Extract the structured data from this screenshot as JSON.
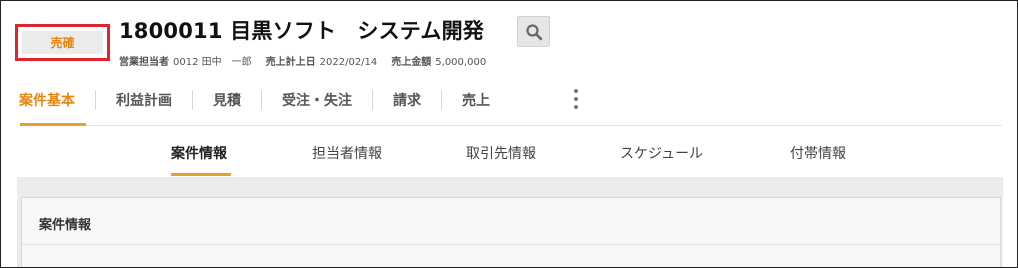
{
  "header": {
    "status_badge": "売確",
    "title": "1800011 目黒ソフト　システム開発",
    "search_icon": "search-icon",
    "meta": [
      {
        "key": "営業担当者",
        "value": "0012 田中　一郎"
      },
      {
        "key": "売上計上日",
        "value": "2022/02/14"
      },
      {
        "key": "売上金額",
        "value": "5,000,000"
      }
    ]
  },
  "tabs": [
    {
      "label": "案件基本",
      "active": true
    },
    {
      "label": "利益計画"
    },
    {
      "label": "見積"
    },
    {
      "label": "受注・失注"
    },
    {
      "label": "請求"
    },
    {
      "label": "売上"
    }
  ],
  "more_icon": "more-vertical-icon",
  "subtabs": [
    {
      "label": "案件情報",
      "active": true
    },
    {
      "label": "担当者情報"
    },
    {
      "label": "取引先情報"
    },
    {
      "label": "スケジュール"
    },
    {
      "label": "付帯情報"
    }
  ],
  "panel": {
    "title": "案件情報"
  },
  "colors": {
    "accent": "#e8860e",
    "highlight_border": "#e0262b"
  }
}
